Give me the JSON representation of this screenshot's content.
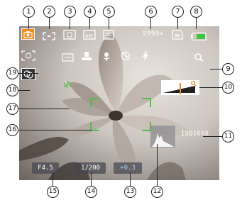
{
  "callouts": [
    "1",
    "2",
    "3",
    "4",
    "5",
    "6",
    "7",
    "8",
    "9",
    "10",
    "11",
    "12",
    "13",
    "14",
    "15",
    "16",
    "17",
    "18",
    "19"
  ],
  "screen": {
    "shots_remaining": "9999+",
    "iso": "ISO1600",
    "aperture": "F4.5",
    "shutter": "1/200",
    "exposure_comp": "+0.3",
    "colors": {
      "mode_active": "#f08a1c",
      "battery": "#3cc83c",
      "focus_frame": "#4cc24a",
      "zoom_marker": "#f08a1c"
    },
    "icons": [
      "scene-mode-icon",
      "metering-icon",
      "image-size-icon",
      "quality-icon",
      "stabilization-icon",
      "memory-card-icon",
      "battery-icon",
      "macro-icon",
      "self-timer-icon",
      "flash-icon",
      "face-detection-icon",
      "zoom-icon",
      "date-stamp-icon",
      "white-balance-icon",
      "continuous-shot-icon",
      "night-mode-icon",
      "shake-warning-icon",
      "histogram-icon"
    ]
  }
}
